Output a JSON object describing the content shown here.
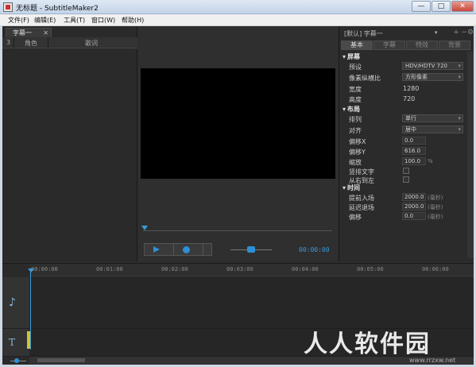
{
  "window": {
    "title": "无标题 - SubtitleMaker2",
    "min": "—",
    "max": "□",
    "close": "✕"
  },
  "menu": [
    "文件(F)",
    "编辑(E)",
    "工具(T)",
    "窗口(W)",
    "帮助(H)"
  ],
  "left_panel": {
    "tab_label": "字幕一",
    "tab_close": "✕",
    "columns": [
      "3",
      "角色",
      "歌词"
    ]
  },
  "preview": {
    "timecode": "00:00:00"
  },
  "right_panel": {
    "header_title": "[默认] 字幕一",
    "tabs": [
      "基本",
      "字幕",
      "特效",
      "背景"
    ],
    "sections": {
      "screen": {
        "title": "屏幕",
        "preset_label": "预设",
        "preset_value": "HDV/HDTV 720",
        "aspect_label": "像素纵横比",
        "aspect_value": "方形像素",
        "width_label": "宽度",
        "width_value": "1280",
        "height_label": "高度",
        "height_value": "720"
      },
      "layout": {
        "title": "布局",
        "arrange_label": "排列",
        "arrange_value": "单行",
        "align_label": "对齐",
        "align_value": "居中",
        "offset_x_label": "偏移X",
        "offset_x_value": "0.0",
        "offset_y_label": "偏移Y",
        "offset_y_value": "616.0",
        "scale_label": "缩放",
        "scale_value": "100.0",
        "scale_unit": "%",
        "vertical_label": "竖排文字",
        "rtl_label": "从右到左"
      },
      "time": {
        "title": "时间",
        "lead_in_label": "提前入场",
        "lead_in_value": "2000.0",
        "lead_in_unit": "(毫秒)",
        "delay_out_label": "延迟退场",
        "delay_out_value": "2000.0",
        "delay_out_unit": "(毫秒)",
        "offset_label": "偏移",
        "offset_value": "0.0",
        "offset_unit": "(毫秒)"
      }
    }
  },
  "timeline": {
    "ticks": [
      "00:00:00",
      "00:01:00",
      "00:02:00",
      "00:03:00",
      "00:04:00",
      "00:05:00",
      "00:06:00"
    ],
    "music_track_icon": "♪",
    "text_track_icon": "T"
  },
  "watermark": {
    "text": "人人软件园",
    "sub": "www.rrzxw.net"
  }
}
